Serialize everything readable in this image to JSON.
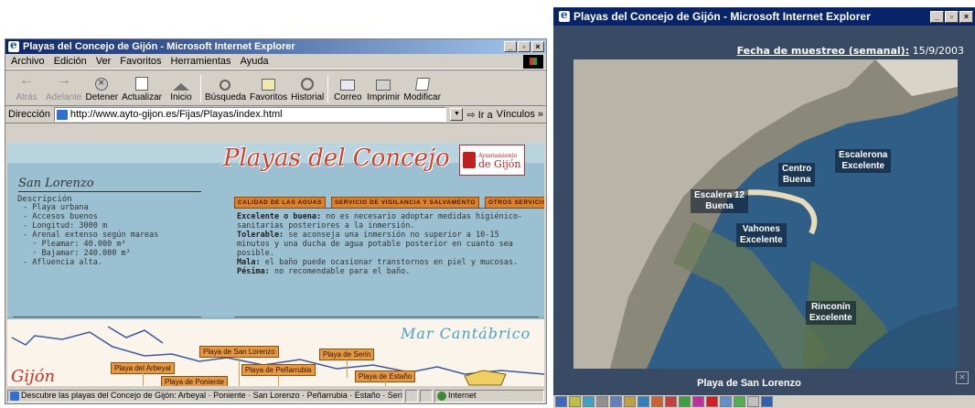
{
  "left_window": {
    "title": "Playas del Concejo de Gijón - Microsoft Internet Explorer",
    "menu": [
      "Archivo",
      "Edición",
      "Ver",
      "Favoritos",
      "Herramientas",
      "Ayuda"
    ],
    "toolbar": [
      "Atrás",
      "Adelante",
      "Detener",
      "Actualizar",
      "Inicio",
      "Búsqueda",
      "Favoritos",
      "Historial",
      "Correo",
      "Imprimir",
      "Modificar"
    ],
    "address_label": "Dirección",
    "address_value": "http://www.ayto-gijon.es/Fijas/Playas/index.html",
    "go_label": "Ir a",
    "links_label": "Vínculos »",
    "page": {
      "logo_text": "Playas del Concejo",
      "ayto_line1": "Ayuntamiento",
      "ayto_line2": "de Gijón",
      "beach_name": "San Lorenzo",
      "desc_title": "Descripción",
      "desc_items": [
        "- Playa urbana",
        "- Accesos buenos",
        "- Longitud: 3000 m",
        "- Arenal extenso según mareas",
        "  · Pleamar: 40.000 m²",
        "  · Bajamar: 240.000 m²",
        "- Afluencia alta."
      ],
      "tabs": [
        "CALIDAD DE LAS AGUAS",
        "SERVICIO DE VIGILANCIA Y SALVAMENTO",
        "OTROS SERVICIOS"
      ],
      "quality": [
        {
          "term": "Excelente o buena:",
          "text": " no es necesario adoptar medidas higiénico-sanitarias posteriores a la inmersión."
        },
        {
          "term": "Tolerable:",
          "text": " se aconseja una inmersión no superior a 10-15 minutos y una ducha de agua potable posterior en cuanto sea posible."
        },
        {
          "term": "Mala:",
          "text": " el baño puede ocasionar transtornos en piel y mucosas."
        },
        {
          "term": "Pésima:",
          "text": " no recomendable para el baño."
        }
      ],
      "map_sea_label": "Mar Cantábrico",
      "map_city_label": "Gijón",
      "beaches": [
        "Playa de San Lorenzo",
        "Playa de Serín",
        "Playa del Arbeyal",
        "Playa de Peñarrubia",
        "Playa de Poniente",
        "Playa de Estaño"
      ]
    },
    "status_text": "Descubre las playas del Concejo de Gijón: Arbeyal · Poniente · San Lorenzo · Peñarrubia · Estaño · Serín",
    "status_zone": "Internet"
  },
  "right_window": {
    "title": "Playas del Concejo de Gijón - Microsoft Internet Explorer",
    "fecha_label": "Fecha de muestreo (semanal):",
    "fecha_value": "15/9/2003",
    "markers": [
      {
        "line1": "Escalerona",
        "line2": "Excelente"
      },
      {
        "line1": "Centro",
        "line2": "Buena"
      },
      {
        "line1": "Escalera 12",
        "line2": "Buena"
      },
      {
        "line1": "Vahones",
        "line2": "Excelente"
      },
      {
        "line1": "Rinconín",
        "line2": "Excelente"
      }
    ],
    "caption": "Playa de San Lorenzo"
  }
}
